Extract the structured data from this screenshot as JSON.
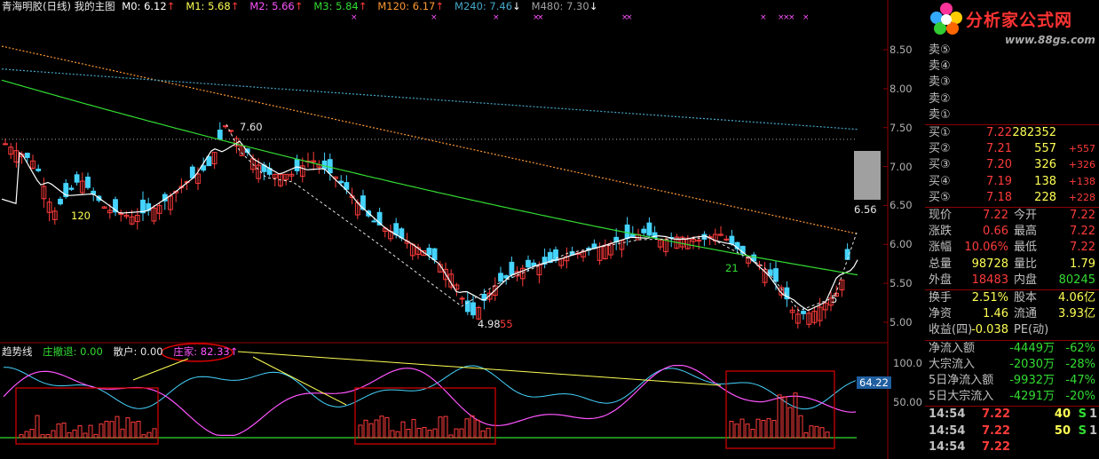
{
  "header": {
    "title": "青海明胶(日线) 我的主图",
    "ma": [
      {
        "label": "M0: 6.12",
        "dir": "↑",
        "color": "#ffffff"
      },
      {
        "label": "M1: 5.68",
        "dir": "↑",
        "color": "#ffff54"
      },
      {
        "label": "M2: 5.66",
        "dir": "↑",
        "color": "#ff54ff"
      },
      {
        "label": "M3: 5.84",
        "dir": "↑",
        "color": "#33dd33"
      },
      {
        "label": "M120: 6.17",
        "dir": "↑",
        "color": "#ff9933"
      },
      {
        "label": "M240: 7.46",
        "dir": "↓",
        "color": "#45a6c9"
      },
      {
        "label": "M480: 7.30",
        "dir": "↓",
        "color": "#a0a0a0"
      }
    ]
  },
  "price_axis": [
    "8.50",
    "8.00",
    "7.50",
    "7.00",
    "6.50",
    "6.00",
    "5.50",
    "5.00"
  ],
  "price_annotations": {
    "high": "7.60",
    "low": "4.98",
    "low_count": "55",
    "mark1": "120",
    "mark2": "21",
    "mark3": "5",
    "current": "6.56"
  },
  "indicator": {
    "name": "趋势线",
    "items": [
      {
        "label": "庄撤退: 0.00",
        "color": "#33dd33"
      },
      {
        "label": "散户: 0.00",
        "color": "#e8e8e8"
      },
      {
        "label": "庄家: 82.33↑",
        "color": "#ff54ff"
      }
    ],
    "axis": [
      "100.0",
      "50.00"
    ],
    "current": "64.22"
  },
  "logo": {
    "text": "分析家公式网",
    "url": "www.88gs.com"
  },
  "order_book": {
    "sell": [
      {
        "label": "卖⑤",
        "price": "",
        "vol": "",
        "chg": ""
      },
      {
        "label": "卖④",
        "price": "",
        "vol": "",
        "chg": ""
      },
      {
        "label": "卖③",
        "price": "",
        "vol": "",
        "chg": ""
      },
      {
        "label": "卖②",
        "price": "",
        "vol": "",
        "chg": ""
      },
      {
        "label": "卖①",
        "price": "",
        "vol": "",
        "chg": ""
      }
    ],
    "buy": [
      {
        "label": "买①",
        "price": "7.22",
        "vol": "282352",
        "chg": ""
      },
      {
        "label": "买②",
        "price": "7.21",
        "vol": "557",
        "chg": "+557"
      },
      {
        "label": "买③",
        "price": "7.20",
        "vol": "326",
        "chg": "+326"
      },
      {
        "label": "买④",
        "price": "7.19",
        "vol": "138",
        "chg": "+138"
      },
      {
        "label": "买⑤",
        "price": "7.18",
        "vol": "228",
        "chg": "+228"
      }
    ]
  },
  "quote": [
    {
      "l1": "现价",
      "v1": "7.22",
      "l2": "今开",
      "v2": "7.22"
    },
    {
      "l1": "涨跌",
      "v1": "0.66",
      "l2": "最高",
      "v2": "7.22"
    },
    {
      "l1": "涨幅",
      "v1": "10.06%",
      "l2": "最低",
      "v2": "7.22"
    },
    {
      "l1": "总量",
      "v1": "98728",
      "l2": "量比",
      "v2": "1.79"
    },
    {
      "l1": "外盘",
      "v1": "18483",
      "l2": "内盘",
      "v2": "80245"
    }
  ],
  "fundamentals": [
    {
      "l1": "换手",
      "v1": "2.51%",
      "l2": "股本",
      "v2": "4.06亿"
    },
    {
      "l1": "净资",
      "v1": "1.46",
      "l2": "流通",
      "v2": "3.93亿"
    },
    {
      "l1": "收益(四)",
      "v1": "-0.038",
      "l2": "PE(动)",
      "v2": ""
    }
  ],
  "fund_flow": [
    {
      "label": "净流入额",
      "amount": "-4449万",
      "pct": "-62%"
    },
    {
      "label": "大宗流入",
      "amount": "-2030万",
      "pct": "-28%"
    },
    {
      "label": "5日净流入额",
      "amount": "-9932万",
      "pct": "-47%"
    },
    {
      "label": "5日大宗流入",
      "amount": "-4291万",
      "pct": "-20%"
    }
  ],
  "ticks": [
    {
      "time": "14:54",
      "price": "7.22",
      "vol": "40",
      "side": "S",
      "n": "1"
    },
    {
      "time": "14:54",
      "price": "7.22",
      "vol": "50",
      "side": "S",
      "n": "1"
    },
    {
      "time": "14:54",
      "price": "7.22",
      "vol": "",
      "side": "",
      "n": ""
    }
  ],
  "chart_data": {
    "type": "candlestick",
    "ylim": [
      4.9,
      8.65
    ],
    "ma_lines": [
      "M0",
      "M1",
      "M2",
      "M3",
      "M120",
      "M240",
      "M480"
    ],
    "indicator_lines": [
      "庄家",
      "散户"
    ],
    "highlight_boxes": 3
  }
}
